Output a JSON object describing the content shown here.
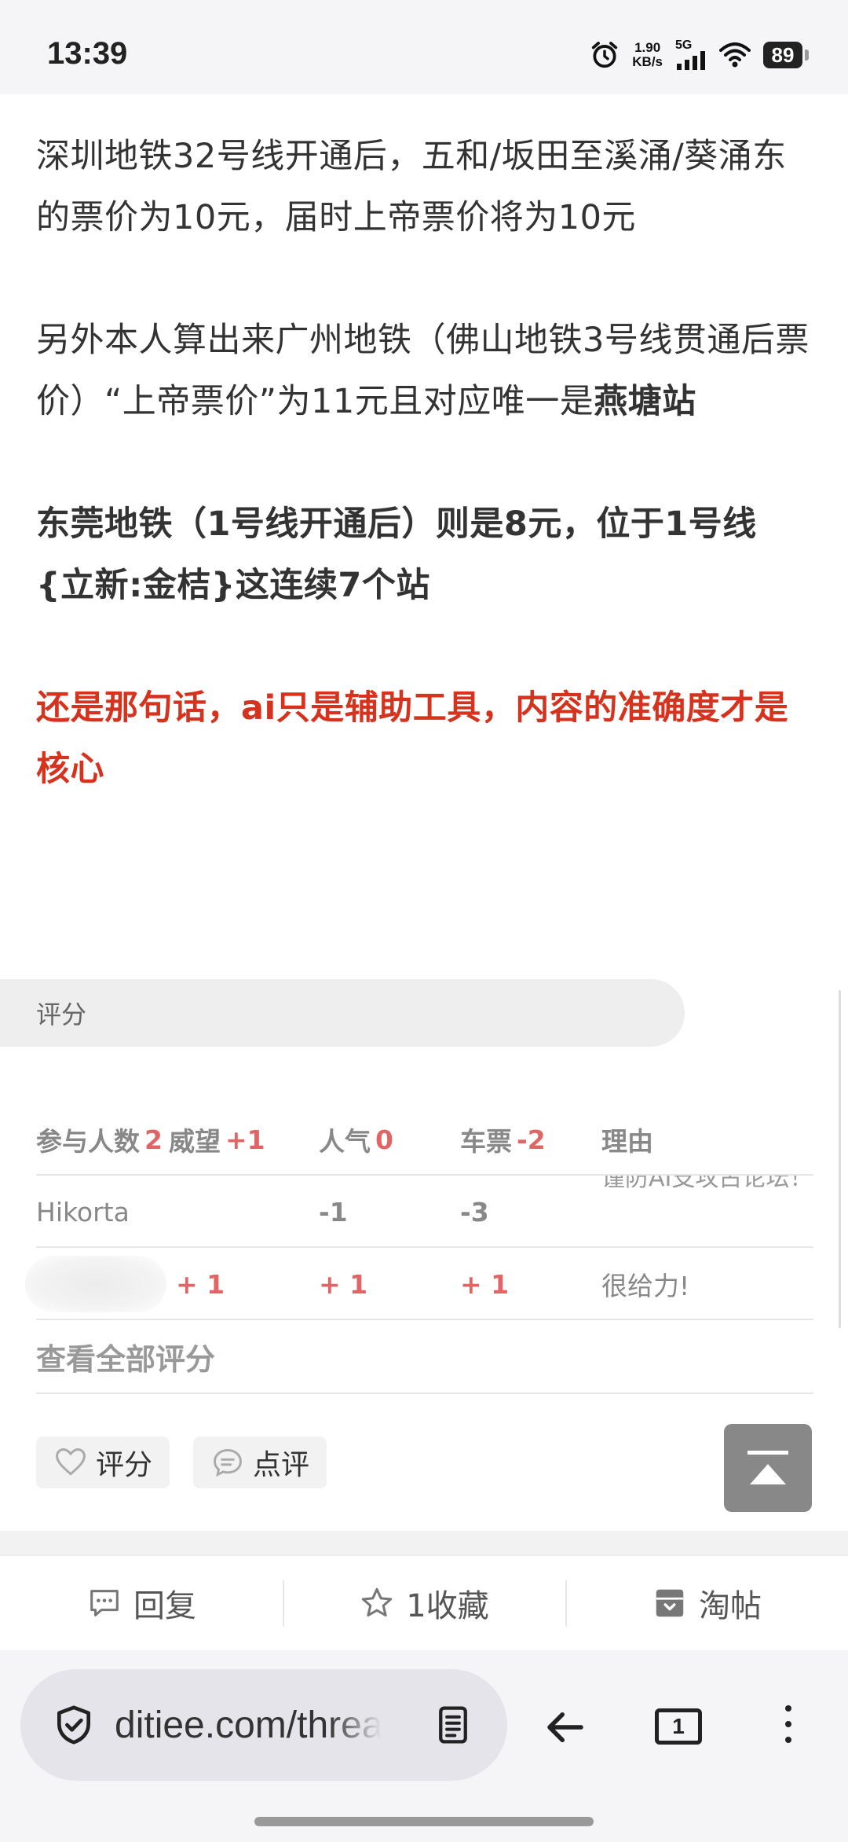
{
  "status_bar": {
    "time": "13:39",
    "net_speed_value": "1.90",
    "net_speed_unit": "KB/s",
    "network_type": "5G",
    "battery": "89"
  },
  "post": {
    "para1": "深圳地铁32号线开通后，五和/坂田至溪涌/葵涌东的票价为10元，届时上帝票价将为10元",
    "para2_plain": "另外本人算出来广州地铁（佛山地铁3号线贯通后票价）“上帝票价”为11元且对应唯一是",
    "para2_bold": "燕塘站",
    "para3": "东莞地铁（1号线开通后）则是8元，位于1号线{立新:金桔}这连续7个站",
    "para4": "还是那句话，ai只是辅助工具，内容的准确度才是核心"
  },
  "rating": {
    "section_label": "评分",
    "header": {
      "participants_label": "参与人数",
      "participants_value": "2",
      "prestige_label": "威望",
      "prestige_value": "+1",
      "popularity_label": "人气",
      "popularity_value": "0",
      "ticket_label": "车票",
      "ticket_value": "-2",
      "reason_label": "理由"
    },
    "rows": [
      {
        "user": "Hikorta",
        "prestige": "",
        "popularity": "-1",
        "ticket": "-3",
        "reason": "谨防AI支攻占论坛！"
      },
      {
        "user": "",
        "prestige": "+ 1",
        "popularity": "+ 1",
        "ticket": "+ 1",
        "reason": "很给力!"
      }
    ],
    "view_all": "查看全部评分",
    "rate_button": "评分",
    "comment_button": "点评"
  },
  "bottom_actions": {
    "reply": "回复",
    "favorite": "1收藏",
    "tao": "淘帖"
  },
  "browser": {
    "url": "ditiee.com/thread",
    "tab_count": "1"
  },
  "colors": {
    "accent_red": "#d6331f",
    "rating_red": "#e06666",
    "muted_gray": "#888888"
  }
}
